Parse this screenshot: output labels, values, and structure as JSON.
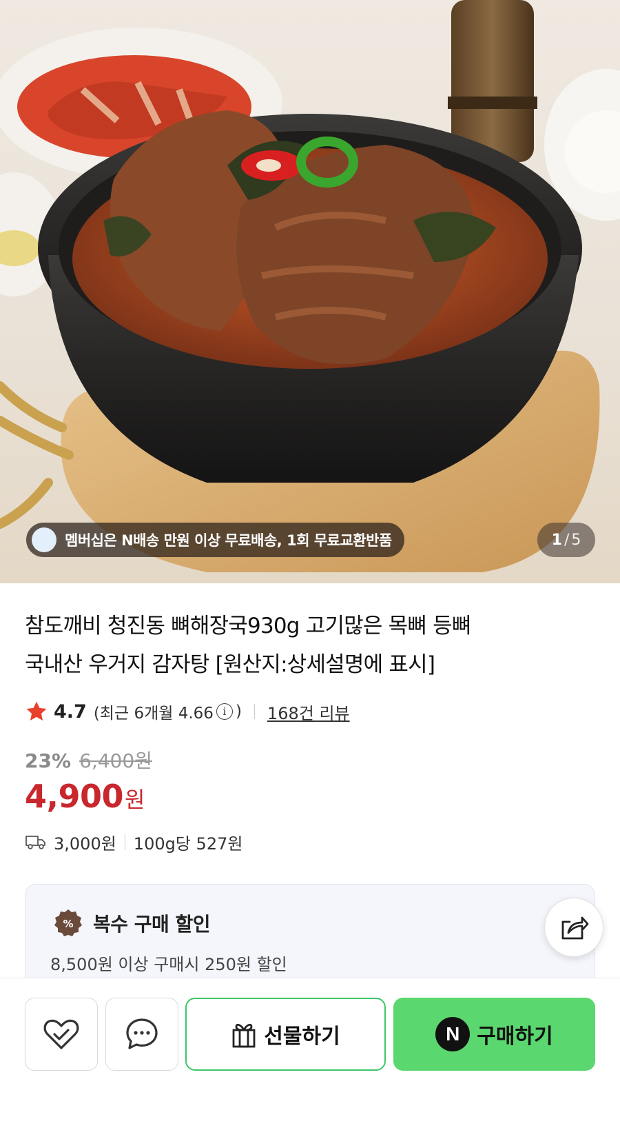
{
  "hero": {
    "image_alt": "",
    "membership_banner": "멤버십은 N배송 만원 이상 무료배송, 1회 무료교환반품",
    "pager_current": "1",
    "pager_separator": "/",
    "pager_total": "5"
  },
  "product": {
    "title_line1": "참도깨비 청진동 뼈해장국930g 고기많은 목뼈 등뼈",
    "title_line2": "국내산 우거지 감자탕 [원산지:상세설명에 표시]",
    "rating": "4.7",
    "recent_rating_prefix": "(최근 6개월 4.66",
    "recent_rating_suffix": ")",
    "review_link": "168건 리뷰",
    "discount_rate": "23%",
    "original_price": "6,400원",
    "price": "4,900",
    "price_unit": "원",
    "shipping_fee": "3,000원",
    "unit_price": "100g당 527원"
  },
  "bulk_discount": {
    "badge": "%",
    "title": "복수 구매 할인",
    "description": "8,500원 이상 구매시 250원 할인"
  },
  "bottom_bar": {
    "gift_label": "선물하기",
    "buy_logo": "N",
    "buy_label": "구매하기"
  },
  "colors": {
    "price_red": "#c8272e",
    "buy_green": "#5ad76e",
    "gift_border_green": "#3ec66b",
    "star_red": "#e8402c"
  },
  "icons": {
    "wishlist": "heart-check-icon",
    "chat": "chat-bubble-icon",
    "gift": "gift-box-icon",
    "share": "share-icon",
    "shipping": "truck-icon",
    "rating": "star-icon",
    "info": "info-icon"
  }
}
